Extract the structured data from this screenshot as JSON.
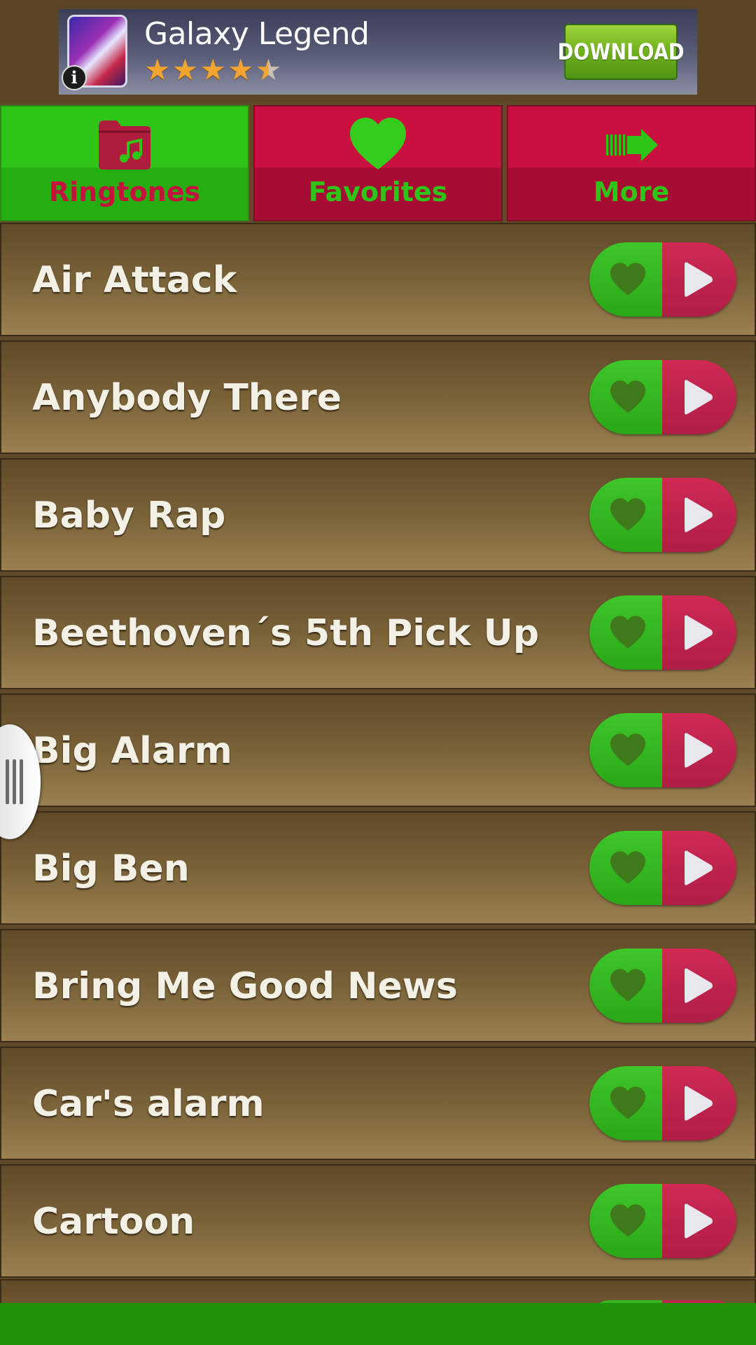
{
  "ad": {
    "title": "Galaxy Legend",
    "rating": 4.5,
    "max_rating": 5,
    "download_label": "DOWNLOAD",
    "info_label": "i",
    "star_color": "#f2a431"
  },
  "tabs": [
    {
      "label": "Ringtones",
      "icon": "music-folder-icon",
      "active": true
    },
    {
      "label": "Favorites",
      "icon": "heart-icon",
      "active": false
    },
    {
      "label": "More",
      "icon": "arrow-right-icon",
      "active": false
    }
  ],
  "ringtones": [
    {
      "title": "Air Attack"
    },
    {
      "title": "Anybody There"
    },
    {
      "title": "Baby Rap"
    },
    {
      "title": "Beethoven´s 5th Pick Up"
    },
    {
      "title": "Big Alarm"
    },
    {
      "title": "Big Ben"
    },
    {
      "title": "Bring Me Good News"
    },
    {
      "title": "Car's alarm"
    },
    {
      "title": "Cartoon"
    }
  ],
  "colors": {
    "active_green": "#2fc418",
    "tab_red": "#c8113e",
    "list_brown": "#7a6238",
    "bottom_bar": "#22920c"
  },
  "icons": {
    "favorite": "heart-icon",
    "play": "play-icon",
    "drawer": "drawer-handle-icon"
  }
}
